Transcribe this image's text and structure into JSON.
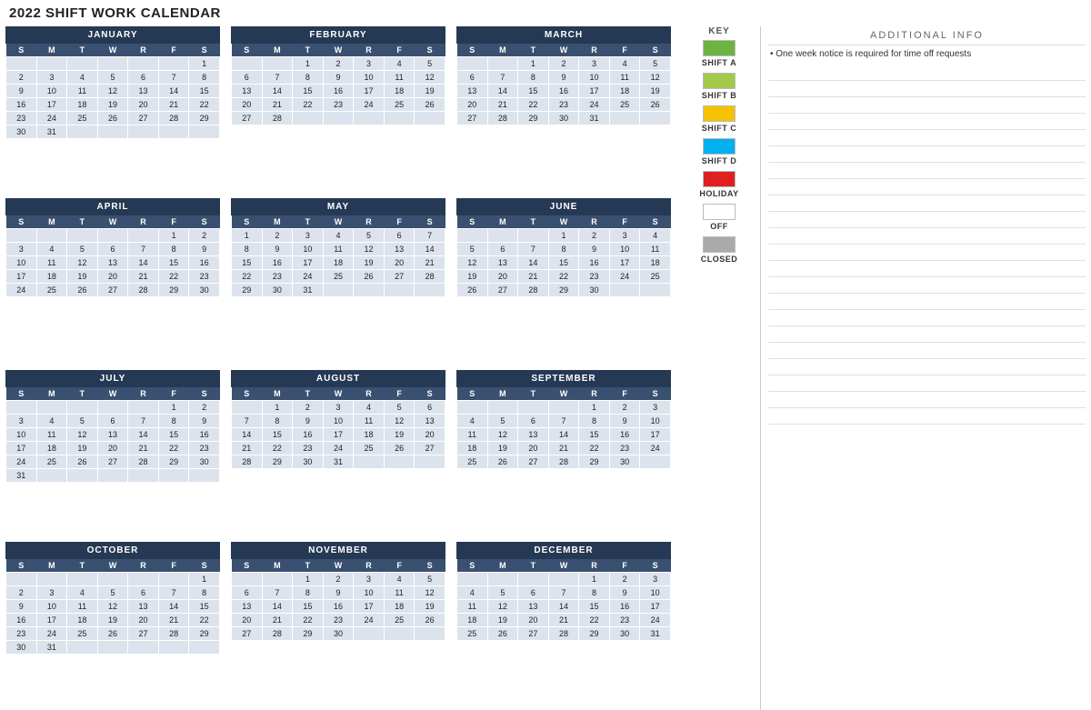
{
  "pageTitle": "2022 SHIFT WORK CALENDAR",
  "keyTitle": "KEY",
  "additionalInfoTitle": "ADDITIONAL  INFO",
  "additionalInfoBullet": "• One week notice is required for time off requests",
  "keyItems": [
    {
      "label": "SHIFT A",
      "swatchClass": "swatch-green-dark"
    },
    {
      "label": "SHIFT B",
      "swatchClass": "swatch-green-light"
    },
    {
      "label": "SHIFT C",
      "swatchClass": "swatch-yellow"
    },
    {
      "label": "SHIFT D",
      "swatchClass": "swatch-blue"
    },
    {
      "label": "HOLIDAY",
      "swatchClass": "swatch-red"
    },
    {
      "label": "OFF",
      "swatchClass": "swatch-white"
    },
    {
      "label": "CLOSED",
      "swatchClass": "swatch-gray"
    }
  ],
  "months": [
    {
      "name": "JANUARY",
      "startDay": 6,
      "days": 31
    },
    {
      "name": "FEBRUARY",
      "startDay": 2,
      "days": 28
    },
    {
      "name": "MARCH",
      "startDay": 2,
      "days": 31
    },
    {
      "name": "APRIL",
      "startDay": 5,
      "days": 30
    },
    {
      "name": "MAY",
      "startDay": 0,
      "days": 31
    },
    {
      "name": "JUNE",
      "startDay": 3,
      "days": 30
    },
    {
      "name": "JULY",
      "startDay": 5,
      "days": 31
    },
    {
      "name": "AUGUST",
      "startDay": 1,
      "days": 31
    },
    {
      "name": "SEPTEMBER",
      "startDay": 4,
      "days": 30
    },
    {
      "name": "OCTOBER",
      "startDay": 6,
      "days": 31
    },
    {
      "name": "NOVEMBER",
      "startDay": 2,
      "days": 30
    },
    {
      "name": "DECEMBER",
      "startDay": 4,
      "days": 31
    }
  ],
  "dayHeaders": [
    "S",
    "M",
    "T",
    "W",
    "R",
    "F",
    "S"
  ]
}
